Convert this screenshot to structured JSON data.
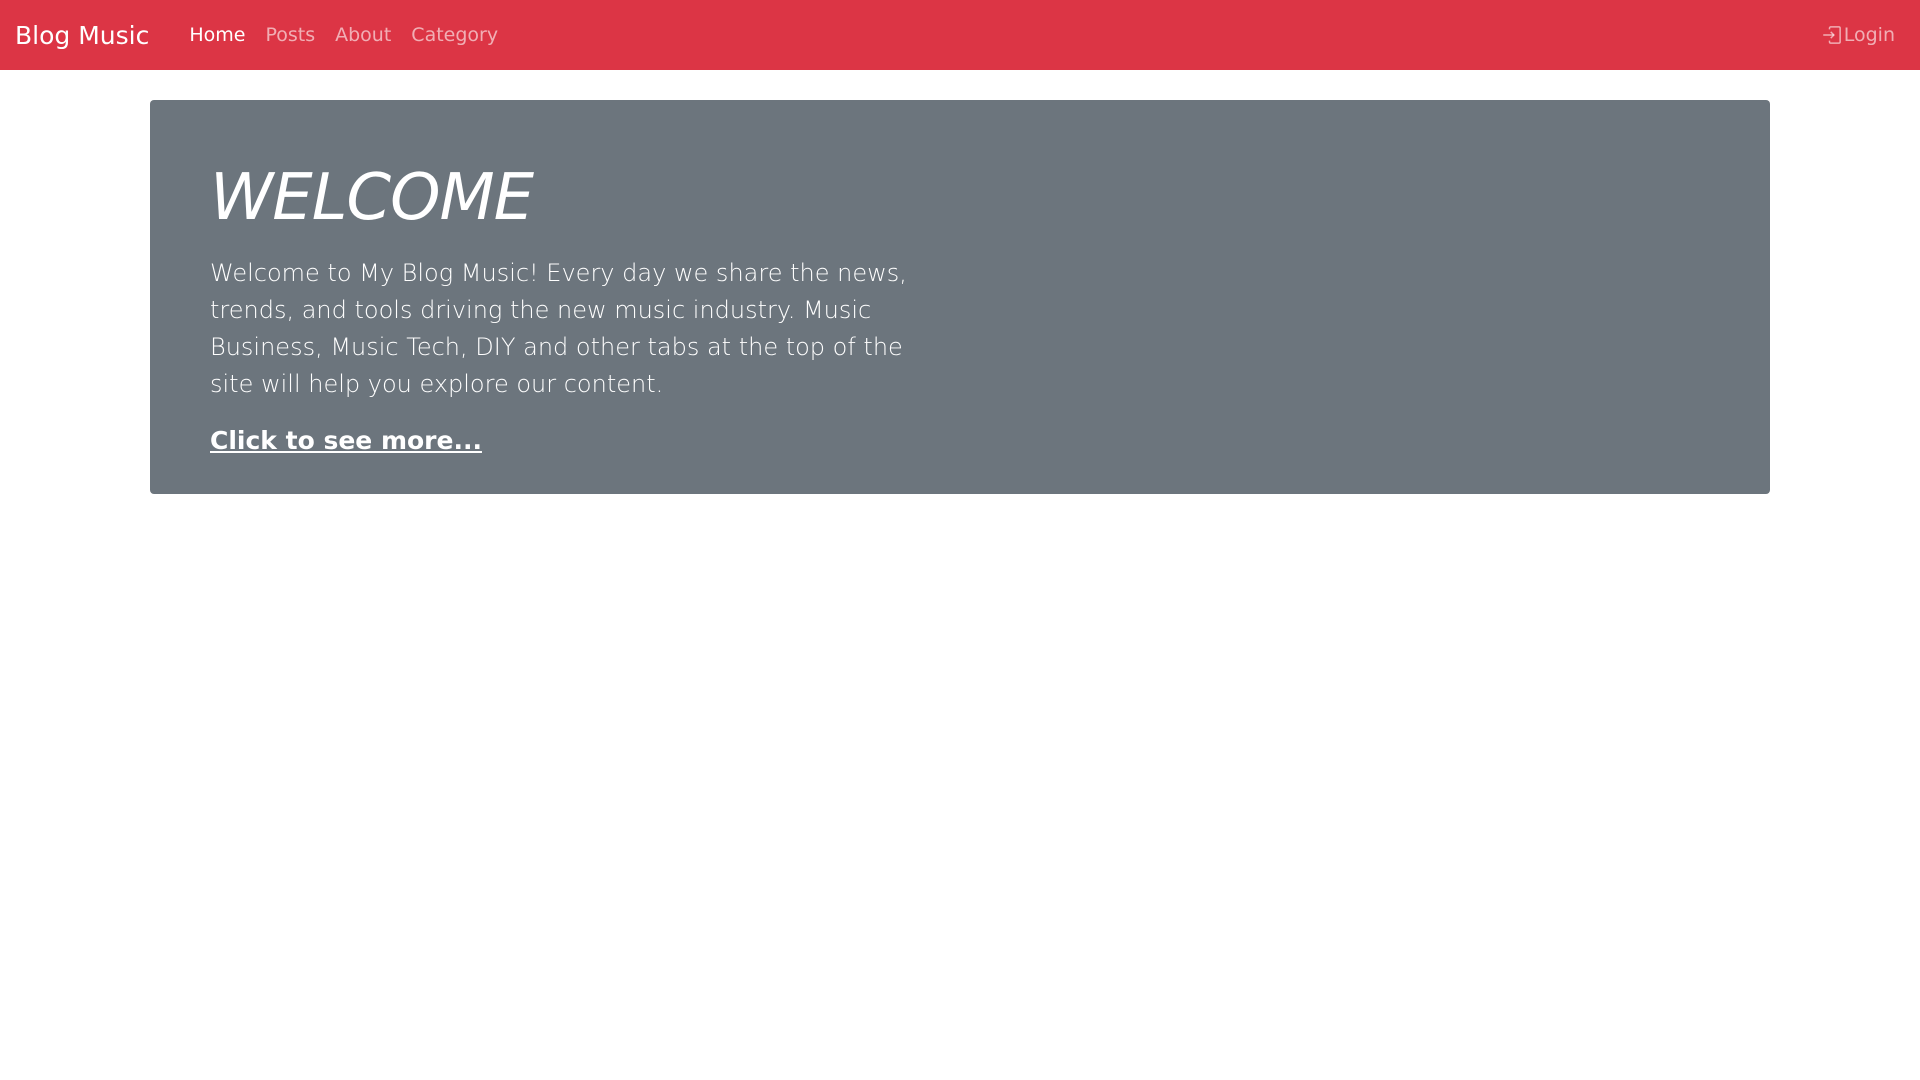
{
  "navbar": {
    "brand": "Blog Music",
    "links": [
      {
        "label": "Home",
        "active": true
      },
      {
        "label": "Posts",
        "active": false
      },
      {
        "label": "About",
        "active": false
      },
      {
        "label": "Category",
        "active": false
      }
    ],
    "login_label": "Login",
    "login_icon": "box-arrow-in-right-icon",
    "background_color": "#dc3545"
  },
  "jumbotron": {
    "title": "WELCOME",
    "text": "Welcome to My Blog Music! Every day we share the news, trends, and tools driving the new music industry. Music Business, Music Tech, DIY and other tabs at the top of the site will help you explore our content.",
    "link_label": "Click to see more...",
    "background_color": "#6c757d"
  }
}
